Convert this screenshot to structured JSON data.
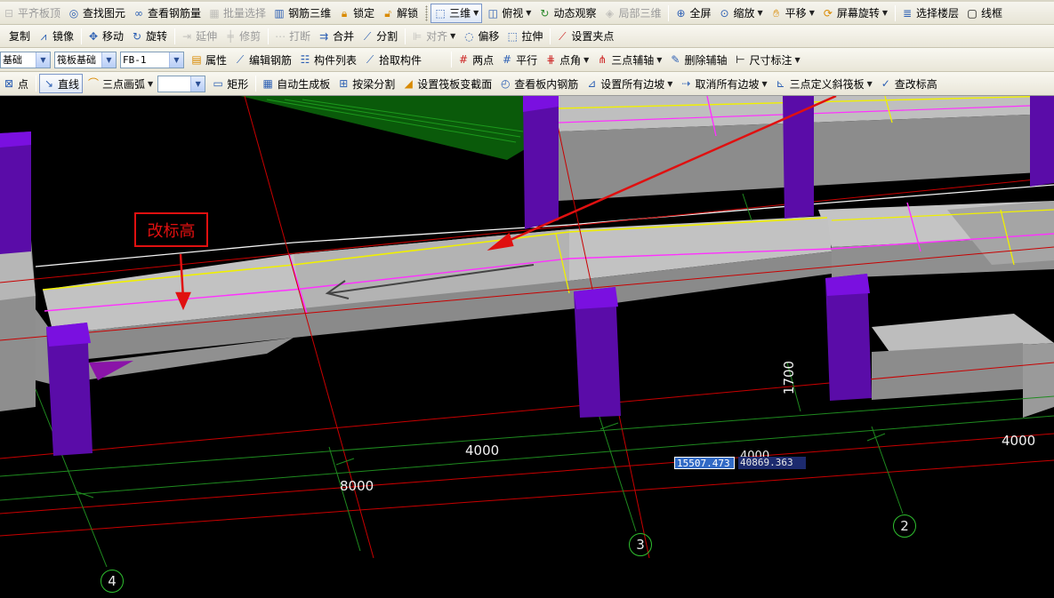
{
  "toolbar_row1": {
    "items": [
      {
        "label": "平齐板顶",
        "icon": "align-top-icon",
        "disabled": true
      },
      {
        "label": "查找图元",
        "icon": "find-binoculars-icon"
      },
      {
        "label": "查看钢筋量",
        "icon": "view-rebar-glasses-icon"
      },
      {
        "label": "批量选择",
        "icon": "batch-select-icon",
        "disabled": true
      },
      {
        "label": "钢筋三维",
        "icon": "rebar-3d-icon"
      },
      {
        "label": "锁定",
        "icon": "lock-icon"
      },
      {
        "label": "解锁",
        "icon": "unlock-icon"
      },
      {
        "label": "三维",
        "icon": "cube-3d-icon",
        "dropdown": true,
        "pressed": true
      },
      {
        "label": "俯视",
        "icon": "top-view-icon",
        "dropdown": true
      },
      {
        "label": "动态观察",
        "icon": "orbit-icon"
      },
      {
        "label": "局部三维",
        "icon": "local-3d-icon",
        "disabled": true
      },
      {
        "label": "全屏",
        "icon": "fullscreen-icon"
      },
      {
        "label": "缩放",
        "icon": "zoom-icon",
        "dropdown": true
      },
      {
        "label": "平移",
        "icon": "pan-hand-icon",
        "dropdown": true
      },
      {
        "label": "屏幕旋转",
        "icon": "screen-rotate-icon",
        "dropdown": true
      },
      {
        "label": "选择楼层",
        "icon": "select-floor-icon"
      },
      {
        "label": "线框",
        "icon": "wireframe-icon"
      }
    ]
  },
  "toolbar_row2": {
    "items": [
      {
        "label": "复制",
        "icon": "copy-icon"
      },
      {
        "label": "镜像",
        "icon": "mirror-icon"
      },
      {
        "label": "移动",
        "icon": "move-icon"
      },
      {
        "label": "旋转",
        "icon": "rotate-icon"
      },
      {
        "label": "延伸",
        "icon": "extend-icon",
        "disabled": true
      },
      {
        "label": "修剪",
        "icon": "trim-icon",
        "disabled": true
      },
      {
        "label": "打断",
        "icon": "break-icon",
        "disabled": true
      },
      {
        "label": "合并",
        "icon": "merge-icon"
      },
      {
        "label": "分割",
        "icon": "split-icon"
      },
      {
        "label": "对齐",
        "icon": "align-icon",
        "disabled": true,
        "dropdown": true
      },
      {
        "label": "偏移",
        "icon": "offset-icon"
      },
      {
        "label": "拉伸",
        "icon": "stretch-icon"
      },
      {
        "label": "设置夹点",
        "icon": "grip-point-icon"
      }
    ]
  },
  "toolbar_row3": {
    "combo_category": "基础",
    "combo_type": "筏板基础",
    "combo_name": "FB-1",
    "items": [
      {
        "label": "属性",
        "icon": "properties-icon"
      },
      {
        "label": "编辑钢筋",
        "icon": "edit-rebar-icon"
      },
      {
        "label": "构件列表",
        "icon": "component-list-icon"
      },
      {
        "label": "拾取构件",
        "icon": "pick-component-icon"
      },
      {
        "label": "两点",
        "icon": "two-point-icon"
      },
      {
        "label": "平行",
        "icon": "parallel-icon"
      },
      {
        "label": "点角",
        "icon": "point-angle-icon",
        "dropdown": true
      },
      {
        "label": "三点辅轴",
        "icon": "three-point-axis-icon",
        "dropdown": true
      },
      {
        "label": "删除辅轴",
        "icon": "delete-axis-icon"
      },
      {
        "label": "尺寸标注",
        "icon": "dimension-icon",
        "dropdown": true
      }
    ]
  },
  "toolbar_row4": {
    "combo_blank": "",
    "items": [
      {
        "label": "点",
        "icon": "point-icon"
      },
      {
        "label": "直线",
        "icon": "line-icon",
        "pressed": true
      },
      {
        "label": "三点画弧",
        "icon": "arc-icon",
        "dropdown": true
      },
      {
        "label": "矩形",
        "icon": "rectangle-icon"
      },
      {
        "label": "自动生成板",
        "icon": "auto-slab-icon"
      },
      {
        "label": "按梁分割",
        "icon": "split-by-beam-icon"
      },
      {
        "label": "设置筏板变截面",
        "icon": "variable-section-icon"
      },
      {
        "label": "查看板内钢筋",
        "icon": "view-slab-rebar-icon"
      },
      {
        "label": "设置所有边坡",
        "icon": "set-slopes-icon",
        "dropdown": true
      },
      {
        "label": "取消所有边坡",
        "icon": "cancel-slopes-icon",
        "dropdown": true
      },
      {
        "label": "三点定义斜筏板",
        "icon": "three-point-slope-icon",
        "dropdown": true
      },
      {
        "label": "查改标高",
        "icon": "edit-elevation-icon"
      }
    ]
  },
  "viewport": {
    "annotation": "改标高",
    "dimensions": {
      "d1": "4000",
      "d2": "8000",
      "d3": "4000",
      "d4": "1700",
      "d5": "4000"
    },
    "axis_labels": {
      "a1": "4",
      "a2": "3",
      "a3": "2"
    },
    "coord_x": "15507.473",
    "coord_y": "40869.363",
    "colors": {
      "column": "#5a0ca8",
      "column_top": "#7a10e0",
      "slab_top": "#bdbdbd",
      "slab_side": "#8a8a8a",
      "grid_red": "#c80000",
      "grid_green": "#1f8a1f",
      "yellow_edge": "#f0f000",
      "magenta": "#ff30ff",
      "annotation_red": "#e01010"
    }
  }
}
